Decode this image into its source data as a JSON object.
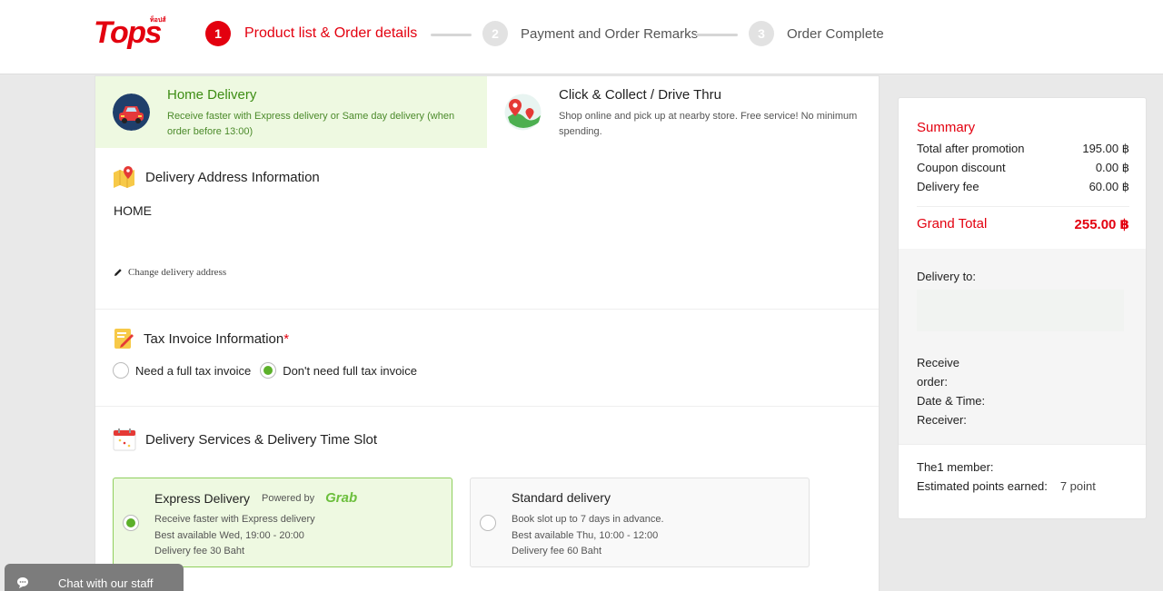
{
  "header": {
    "logo_text": "Tops",
    "logo_sub": "ท็อปส์",
    "steps": [
      {
        "num": "1",
        "label": "Product list & Order details"
      },
      {
        "num": "2",
        "label": "Payment and Order Remarks"
      },
      {
        "num": "3",
        "label": "Order Complete"
      }
    ],
    "active_step": 1
  },
  "delivery_tabs": [
    {
      "title": "Home Delivery",
      "desc": "Receive faster with Express delivery or Same day delivery (when order before 13:00)",
      "selected": true
    },
    {
      "title": "Click & Collect / Drive Thru",
      "desc": "Shop online and pick up at nearby store. Free service! No minimum spending.",
      "selected": false
    }
  ],
  "address": {
    "title": "Delivery Address Information",
    "label": "HOME",
    "change_link": "Change delivery address"
  },
  "tax": {
    "title": "Tax Invoice Information",
    "required_mark": "*",
    "options": [
      {
        "label": "Need a full tax invoice",
        "selected": false
      },
      {
        "label": "Don't need full tax invoice",
        "selected": true
      }
    ]
  },
  "services": {
    "title": "Delivery Services & Delivery Time Slot",
    "cards": [
      {
        "title": "Express Delivery",
        "powered_by": "Powered by",
        "partner": "Grab",
        "lines": [
          "Receive faster with Express delivery",
          "Best available Wed, 19:00 - 20:00",
          "Delivery fee 30 Baht"
        ],
        "selected": true
      },
      {
        "title": "Standard delivery",
        "lines": [
          "Book slot up to 7 days in advance.",
          "Best available Thu, 10:00 - 12:00",
          "Delivery fee 60 Baht"
        ],
        "selected": false
      }
    ]
  },
  "summary": {
    "title": "Summary",
    "rows": [
      {
        "label": "Total after promotion",
        "value": "195.00 ฿"
      },
      {
        "label": "Coupon discount",
        "value": "0.00 ฿"
      },
      {
        "label": "Delivery fee",
        "value": "60.00 ฿"
      }
    ],
    "grand_total_label": "Grand Total",
    "grand_total_value": "255.00 ฿",
    "delivery_to": "Delivery to:",
    "receive_order_1": "Receive",
    "receive_order_2": "order:",
    "date_time": "Date & Time:",
    "receiver": "Receiver:",
    "member_label": "The1 member:",
    "points_label": "Estimated points earned:",
    "points_value": "7 point"
  },
  "chat": {
    "label": "Chat with our staff"
  },
  "colors": {
    "brand": "#e3000f",
    "green": "#5cb02a",
    "tab_selected_bg": "#eef9e1"
  }
}
